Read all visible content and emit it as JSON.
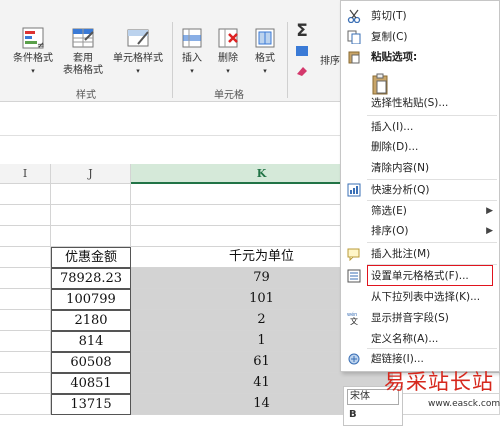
{
  "ribbon": {
    "conditional_format": "条件格式",
    "apply_table_1": "套用",
    "apply_table_2": "表格格式",
    "cell_styles": "单元格样式",
    "styles_group": "样式",
    "insert": "插入",
    "delete": "删除",
    "format": "格式",
    "cells_group": "单元格",
    "sort_partial": "排序",
    "autosum_symbol": "Σ"
  },
  "columns": {
    "i": "I",
    "j": "J",
    "k": "K"
  },
  "table": {
    "header_j": "优惠金额",
    "header_k": "千元为单位",
    "rows": [
      {
        "j": "78928.23",
        "k": "79"
      },
      {
        "j": "100799",
        "k": "101"
      },
      {
        "j": "2180",
        "k": "2"
      },
      {
        "j": "814",
        "k": "1"
      },
      {
        "j": "60508",
        "k": "61"
      },
      {
        "j": "40851",
        "k": "41"
      },
      {
        "j": "13715",
        "k": "14"
      }
    ]
  },
  "context_menu": {
    "cut": "剪切(T)",
    "copy": "复制(C)",
    "paste_options": "粘贴选项:",
    "paste_special": "选择性粘贴(S)...",
    "insert": "插入(I)...",
    "delete": "删除(D)...",
    "clear": "清除内容(N)",
    "quick_analysis": "快速分析(Q)",
    "filter": "筛选(E)",
    "sort": "排序(O)",
    "insert_comment": "插入批注(M)",
    "format_cells": "设置单元格格式(F)...",
    "pick_from_list": "从下拉列表中选择(K)...",
    "phonetic": "显示拼音字段(S)",
    "define_name": "定义名称(A)...",
    "hyperlink": "超链接(I)...",
    "highlight_color": "#e0141e"
  },
  "mini_toolbar": {
    "font": "宋体",
    "bold": "B"
  },
  "watermark": {
    "title": "易采站长站",
    "url": "www.easck.com"
  }
}
